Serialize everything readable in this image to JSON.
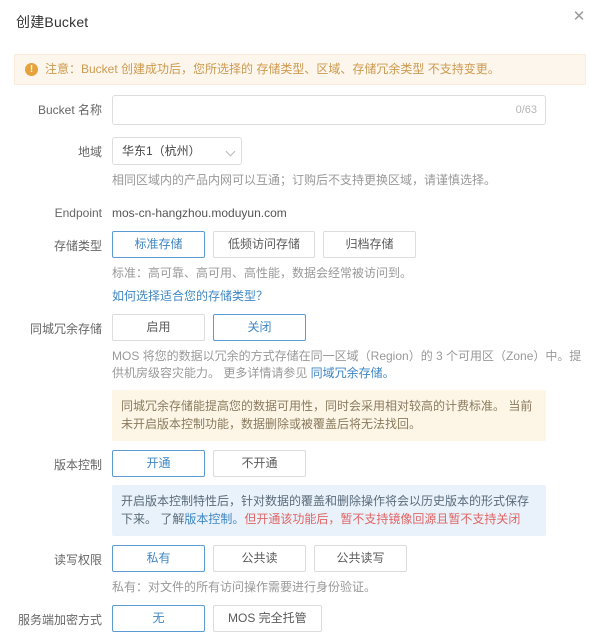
{
  "dialog": {
    "title": "创建Bucket",
    "close_icon": "close-icon"
  },
  "notice": {
    "icon": "exclamation-circle-icon",
    "text": "注意：Bucket 创建成功后，您所选择的 存储类型、区域、存储冗余类型 不支持变更。"
  },
  "form": {
    "bucket_name": {
      "label": "Bucket 名称",
      "value": "",
      "placeholder": "",
      "counter": "0/63"
    },
    "region": {
      "label": "地域",
      "selected": "华东1（杭州）",
      "options": [
        "华东1（杭州）"
      ],
      "hint": "相同区域内的产品内网可以互通；订购后不支持更换区域，请谨慎选择。"
    },
    "endpoint": {
      "label": "Endpoint",
      "value": "mos-cn-hangzhou.moduyun.com"
    },
    "storage_class": {
      "label": "存储类型",
      "options": [
        "标准存储",
        "低频访问存储",
        "归档存储"
      ],
      "selected_index": 0,
      "hint": "标准：高可靠、高可用、高性能，数据会经常被访问到。",
      "link": "如何选择适合您的存储类型？"
    },
    "zone_redundancy": {
      "label": "同城冗余存储",
      "options": [
        "启用",
        "关闭"
      ],
      "selected_index": 1,
      "hint_before": "MOS 将您的数据以冗余的方式存储在同一区域（Region）的 3 个可用区（Zone）中。提供机房级容灾能力。 更多详情请参见 ",
      "hint_link": "同域冗余存储。",
      "info_box": "同城冗余存储能提高您的数据可用性，同时会采用相对较高的计费标准。 当前未开启版本控制功能，数据删除或被覆盖后将无法找回。"
    },
    "versioning": {
      "label": "版本控制",
      "options": [
        "开通",
        "不开通"
      ],
      "selected_index": 0,
      "info_text": "开启版本控制特性后，针对数据的覆盖和删除操作将会以历史版本的形式保存下来。 了解",
      "info_link": "版本控制。",
      "info_red": "但开通该功能后，暂不支持镜像回源且暂不支持关闭"
    },
    "acl": {
      "label": "读写权限",
      "options": [
        "私有",
        "公共读",
        "公共读写"
      ],
      "selected_index": 0,
      "hint": "私有：对文件的所有访问操作需要进行身份验证。"
    },
    "encryption": {
      "label": "服务端加密方式",
      "options": [
        "无",
        "MOS 完全托管"
      ],
      "selected_index": 0
    }
  },
  "colors": {
    "accent": "#3f87c4",
    "selected_border": "#5b9bd1",
    "warn_bg": "#fdf6ec",
    "warn_text": "#cd9a50",
    "info_blue_bg": "#e9f2fa",
    "info_red_text": "#e06666"
  }
}
